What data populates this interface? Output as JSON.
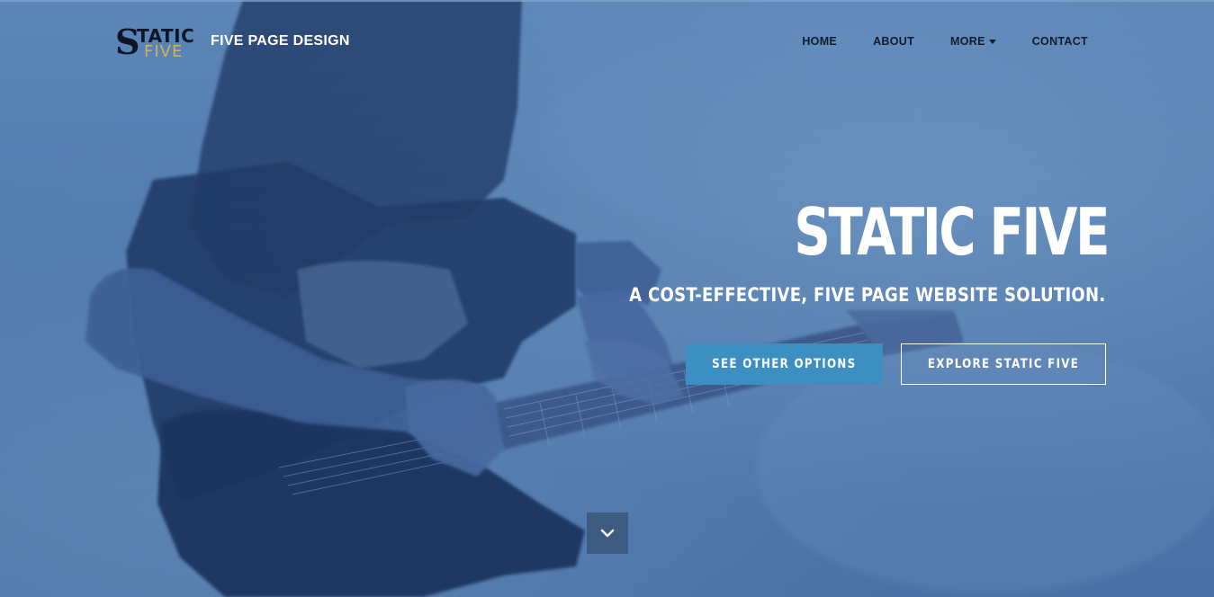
{
  "brand": {
    "logo_line1": "TATIC",
    "logo_initial": "S",
    "logo_line2": "FIVE",
    "tagline": "FIVE PAGE DESIGN"
  },
  "nav": {
    "items": [
      {
        "label": "HOME"
      },
      {
        "label": "ABOUT"
      },
      {
        "label": "MORE",
        "has_dropdown": true
      },
      {
        "label": "CONTACT"
      }
    ]
  },
  "hero": {
    "title": "STATIC FIVE",
    "subtitle": "A COST-EFFECTIVE, FIVE PAGE WEBSITE SOLUTION.",
    "primary_button": "SEE OTHER OPTIONS",
    "secondary_button": "EXPLORE STATIC FIVE",
    "scroll_icon": "chevron-down-icon"
  },
  "colors": {
    "overlay": "#5079ad",
    "primary_button": "#3d8ec1",
    "logo_accent": "#d4b451",
    "nav_text": "#0f1c30"
  }
}
